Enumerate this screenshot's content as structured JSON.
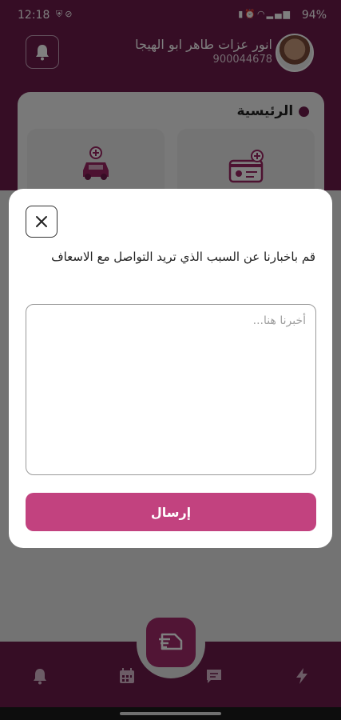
{
  "status_bar": {
    "time": "12:18",
    "battery": "94%",
    "left_icons": [
      "shield-icon",
      "block-icon"
    ],
    "right_icons": [
      "sim-icon",
      "alarm-icon",
      "wifi-icon",
      "signal-icon",
      "signal-icon"
    ]
  },
  "header": {
    "user_name": "انور عزات طاهر ابو الهيجا",
    "phone": "900044678"
  },
  "main": {
    "section_title": "الرئيسية"
  },
  "modal": {
    "prompt": "قم باخبارنا عن السبب الذي تريد التواصل مع الاسعاف",
    "placeholder": "أخبرنا هنا...",
    "message_value": "",
    "send_label": "إرسال"
  },
  "colors": {
    "brand": "#6d1a4a",
    "accent": "#c2427f"
  },
  "bottom_nav": {
    "items": [
      "bell-icon",
      "calendar-icon",
      "chat-icon",
      "lightning-icon"
    ],
    "center": "ambulance-logo-icon"
  }
}
